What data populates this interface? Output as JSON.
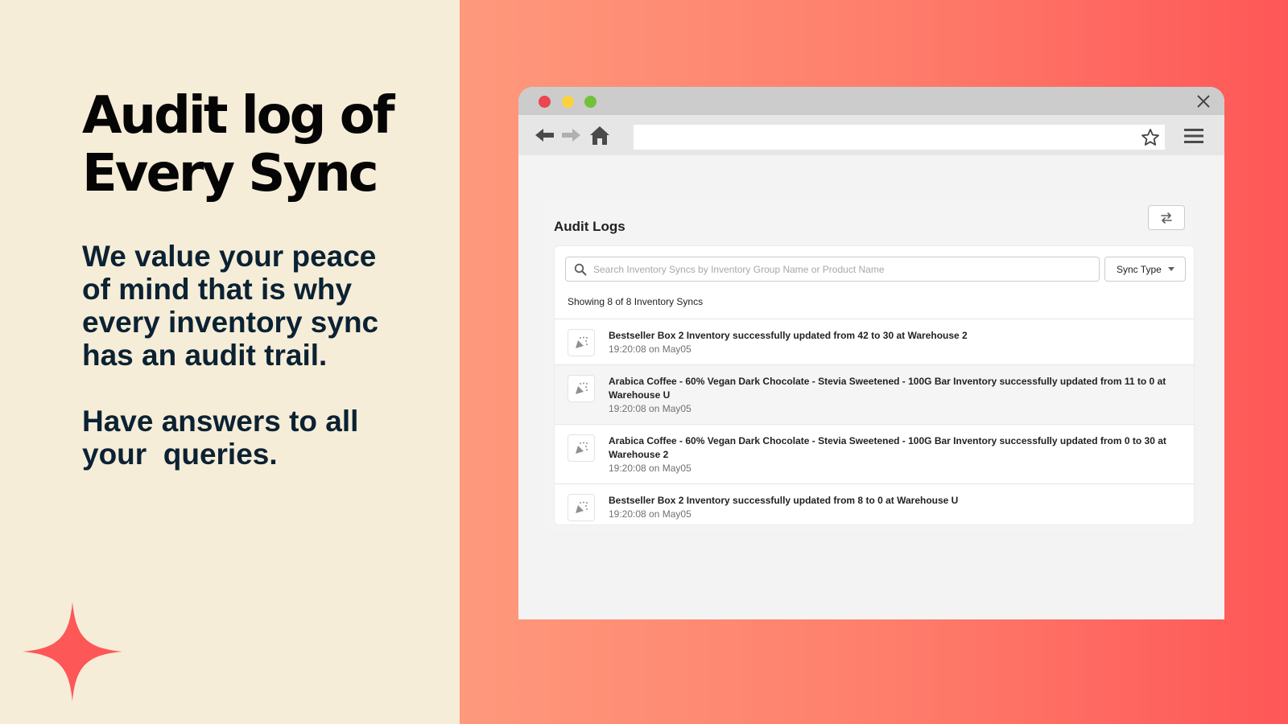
{
  "promo": {
    "headline_lines": [
      "Audit log of",
      "Every Sync"
    ],
    "paragraph_1": "We value your peace of mind that is why every inventory sync has an audit trail.",
    "paragraph_2": "Have answers to all your  queries.",
    "accent_color": "#fe5757",
    "sparkle_icon": "four-point-star-icon"
  },
  "browser": {
    "url": "",
    "icons": {
      "back": "arrow-left-icon",
      "forward": "arrow-right-icon",
      "home": "home-icon",
      "bookmark": "star-icon",
      "menu": "hamburger-icon",
      "close": "close-icon"
    }
  },
  "audit": {
    "title": "Audit Logs",
    "refresh_icon": "swap-arrows-icon",
    "search_placeholder": "Search Inventory Syncs by Inventory Group Name or Product Name",
    "search_value": "",
    "filter_label": "Sync Type",
    "showing_text": "Showing 8 of 8 Inventory Syncs",
    "entries": [
      {
        "title": "Bestseller Box 2 Inventory successfully updated from 42 to 30 at Warehouse 2",
        "time": "19:20:08 on May05",
        "icon": "party-popper-icon"
      },
      {
        "title": "Arabica Coffee - 60% Vegan Dark Chocolate - Stevia Sweetened - 100G Bar Inventory successfully updated from 11 to 0 at Warehouse U",
        "time": "19:20:08 on May05",
        "icon": "party-popper-icon"
      },
      {
        "title": "Arabica Coffee - 60% Vegan Dark Chocolate - Stevia Sweetened - 100G Bar Inventory successfully updated from 0 to 30 at Warehouse 2",
        "time": "19:20:08 on May05",
        "icon": "party-popper-icon"
      },
      {
        "title": "Bestseller Box 2 Inventory successfully updated from 8 to 0 at Warehouse U",
        "time": "19:20:08 on May05",
        "icon": "party-popper-icon"
      }
    ]
  }
}
